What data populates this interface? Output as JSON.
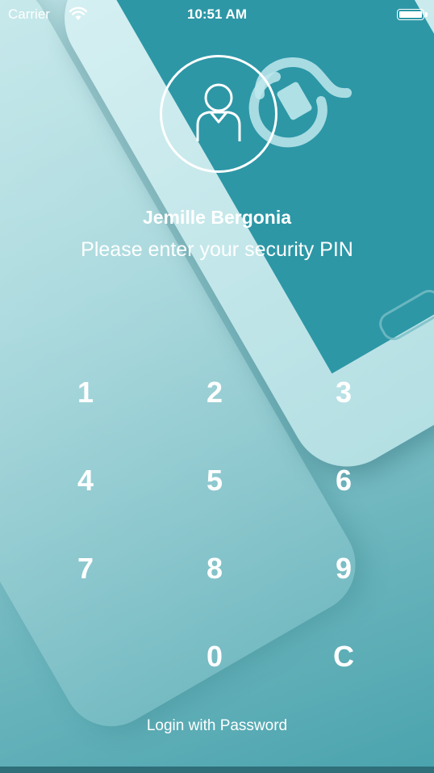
{
  "status_bar": {
    "carrier": "Carrier",
    "time": "10:51 AM",
    "wifi_icon": "wifi-icon",
    "battery_icon": "battery-full-icon"
  },
  "profile": {
    "avatar_icon": "user-avatar-icon",
    "name": "Jemille Bergonia",
    "prompt": "Please enter your security PIN"
  },
  "keypad": {
    "keys": [
      "1",
      "2",
      "3",
      "4",
      "5",
      "6",
      "7",
      "8",
      "9",
      "0",
      "C"
    ]
  },
  "footer": {
    "login_with_password": "Login with Password"
  },
  "colors": {
    "text": "#ffffff",
    "phone_screen": "#2d97a6",
    "background_light": "#bfe3e6",
    "background_dark": "#4aa3ad"
  }
}
